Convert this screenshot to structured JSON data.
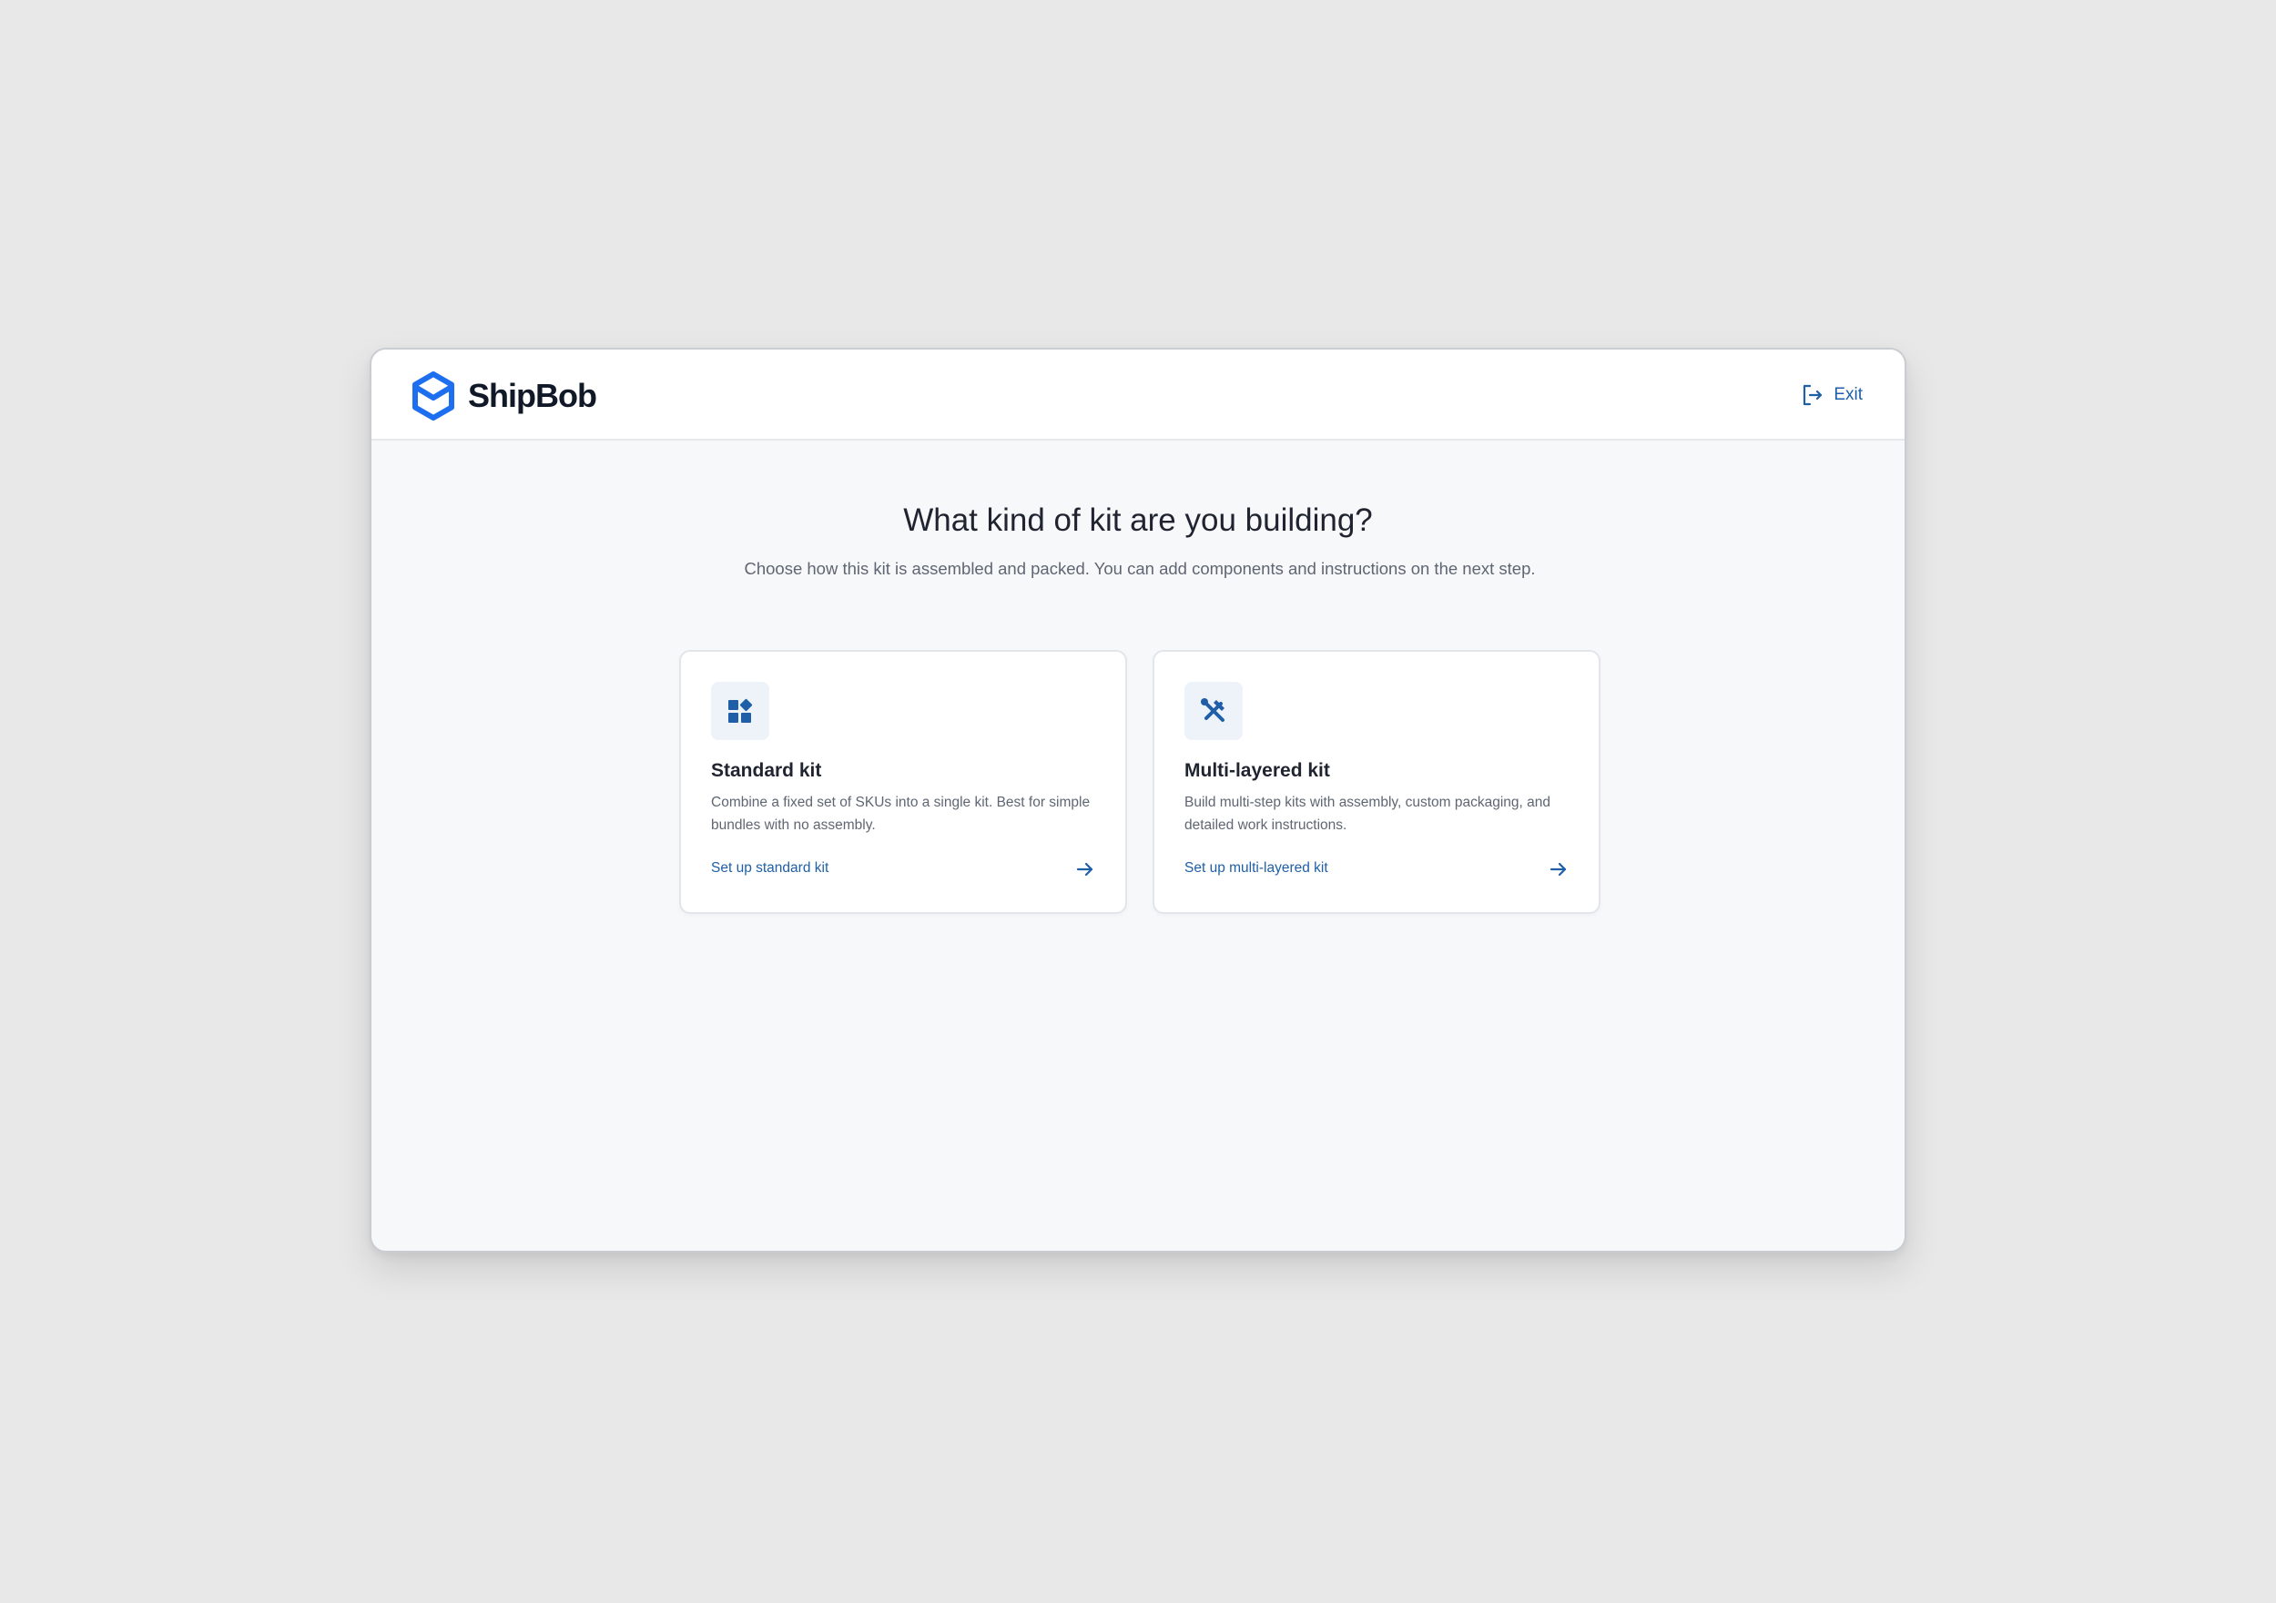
{
  "header": {
    "brand_name": "ShipBob",
    "exit_label": "Exit"
  },
  "main": {
    "title": "What kind of kit are you building?",
    "subtitle": "Choose how this kit is assembled and packed. You can add components and instructions on the next step.",
    "cards": [
      {
        "icon": "widgets-icon",
        "title": "Standard kit",
        "description": "Combine a fixed set of SKUs into a single kit. Best for simple bundles with no assembly.",
        "link_label": "Set up standard kit"
      },
      {
        "icon": "tools-icon",
        "title": "Multi-layered kit",
        "description": "Build multi-step kits with assembly, custom packaging, and detailed work instructions.",
        "link_label": "Set up multi-layered kit"
      }
    ]
  },
  "colors": {
    "brand_blue": "#1e6ff0",
    "link_blue": "#1f5fa8",
    "icon_blue": "#1f5fa8",
    "icon_bg": "#edf3f9"
  }
}
